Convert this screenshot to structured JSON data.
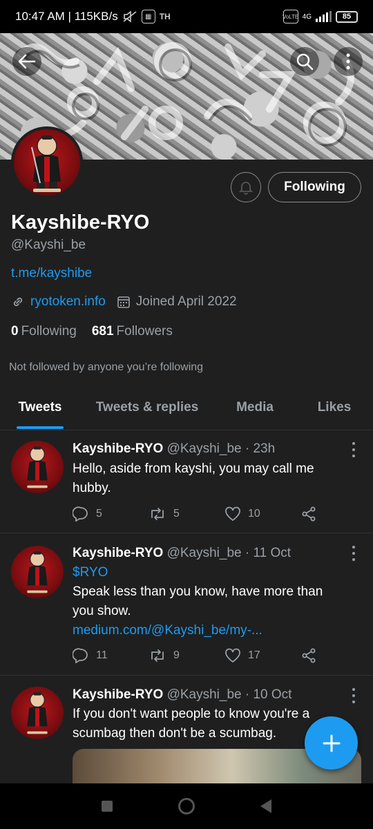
{
  "status_bar": {
    "time_speed": "10:47 AM | 115KB/s",
    "carrier_tag": "TH",
    "network": "4G",
    "battery": "85"
  },
  "profile": {
    "display_name": "Kayshibe-RYO",
    "handle": "@Kayshi_be",
    "bio_link": "t.me/kayshibe",
    "website": "ryotoken.info",
    "joined": "Joined April 2022",
    "following_count": "0",
    "following_label": "Following",
    "followers_count": "681",
    "followers_label": "Followers",
    "follow_button": "Following",
    "not_followed_note": "Not followed by anyone you’re following"
  },
  "tabs": [
    {
      "label": "Tweets",
      "active": true
    },
    {
      "label": "Tweets & replies",
      "active": false
    },
    {
      "label": "Media",
      "active": false
    },
    {
      "label": "Likes",
      "active": false
    }
  ],
  "tweets": [
    {
      "name": "Kayshibe-RYO",
      "handle_time": "@Kayshi_be · 23h",
      "line1": "Hello, aside from kayshi, you may call me",
      "line2": "hubby.",
      "replies": "5",
      "retweets": "5",
      "likes": "10"
    },
    {
      "name": "Kayshibe-RYO",
      "handle_time": "@Kayshi_be · 11 Oct",
      "cashtag": "$RYO",
      "line1": "Speak less than you know, have more than",
      "line2": "you show.",
      "link": "medium.com/@Kayshi_be/my-...",
      "replies": "11",
      "retweets": "9",
      "likes": "17"
    },
    {
      "name": "Kayshibe-RYO",
      "handle_time": "@Kayshi_be · 10 Oct",
      "line1": "If you don't want people to know you're a",
      "line2": "scumbag then don't be a scumbag."
    }
  ],
  "colors": {
    "accent": "#1d9bf0",
    "background": "#1f1f1f",
    "secondary_text": "#9aa0a6"
  }
}
